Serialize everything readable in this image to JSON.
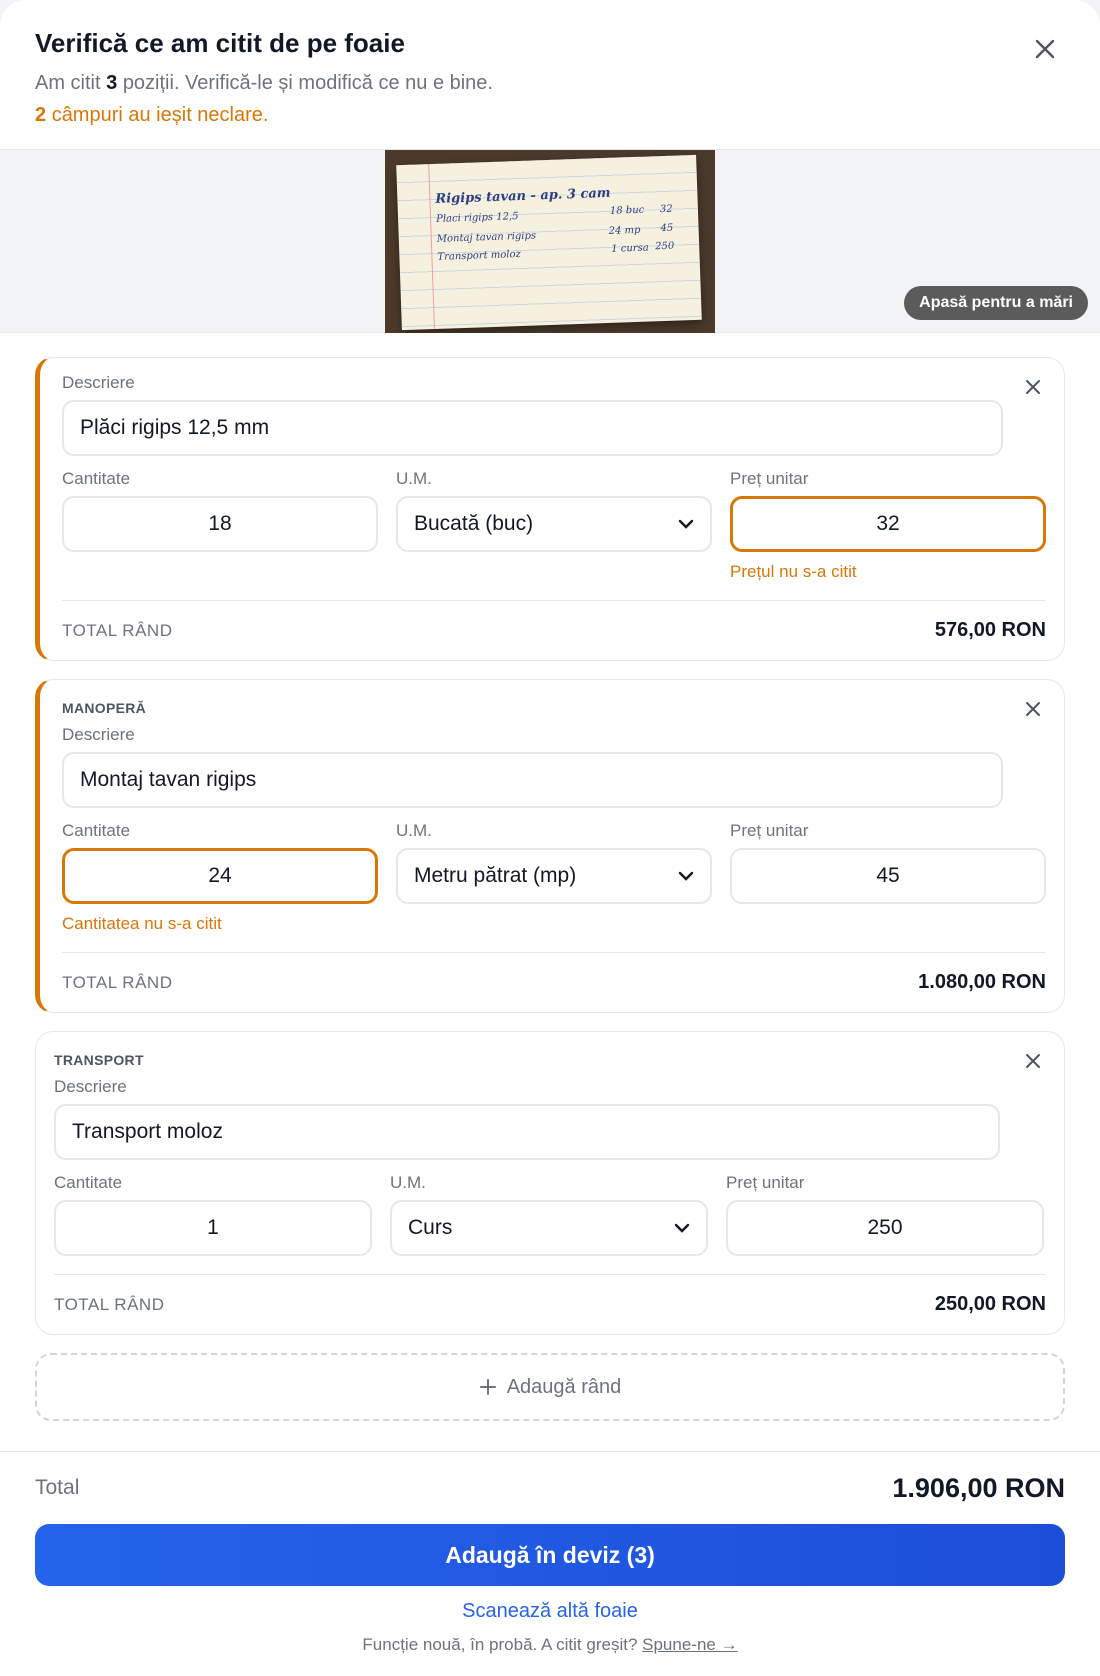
{
  "header": {
    "title": "Verifică ce am citit de pe foaie",
    "subtitle_prefix": "Am citit",
    "subtitle_count": "3",
    "subtitle_suffix": "poziții. Verifică-le și modifică ce nu e bine.",
    "warning_count": "2",
    "warning_text": "câmpuri au ieșit neclare.",
    "close_icon": "close-icon"
  },
  "photo": {
    "paper_title": "Rigips tavan - ap. 3 cam",
    "paper_lines": [
      {
        "desc": "Placi rigips 12,5",
        "qty": "18 buc",
        "price": "32"
      },
      {
        "desc": "Montaj tavan rigips",
        "qty": "24 mp",
        "price": "45"
      },
      {
        "desc": "Transport moloz",
        "qty": "1 cursa",
        "price": "250"
      }
    ],
    "zoom_label": "Apasă pentru a mări"
  },
  "labels": {
    "description": "Descriere",
    "quantity": "Cantitate",
    "unit": "U.M.",
    "unit_price": "Preț unitar",
    "row_total": "TOTAL RÂND"
  },
  "items": [
    {
      "category": "",
      "description": "Plăci rigips 12,5 mm",
      "quantity": "18",
      "unit": "Bucată (buc)",
      "unit_price": "32",
      "error_field": "price",
      "error_msg": "Prețul nu s-a citit",
      "total": "576,00 RON"
    },
    {
      "category": "MANOPERĂ",
      "description": "Montaj tavan rigips",
      "quantity": "24",
      "unit": "Metru pătrat (mp)",
      "unit_price": "45",
      "error_field": "quantity",
      "error_msg": "Cantitatea nu s-a citit",
      "total": "1.080,00 RON"
    },
    {
      "category": "TRANSPORT",
      "description": "Transport moloz",
      "quantity": "1",
      "unit": "Curs",
      "unit_price": "250",
      "error_field": "",
      "error_msg": "",
      "total": "250,00 RON"
    }
  ],
  "add_row_label": "Adaugă rând",
  "footer": {
    "total_label": "Total",
    "total_value": "1.906,00 RON",
    "cta_label": "Adaugă în deviz (3)",
    "secondary_label": "Scanează altă foaie",
    "feedback_text": "Funcție nouă, în probă. A citit greșit?",
    "feedback_link": "Spune-ne →"
  },
  "colors": {
    "accent": "#2563eb",
    "warning": "#d97706",
    "text": "#111827",
    "muted": "#6b7280"
  }
}
